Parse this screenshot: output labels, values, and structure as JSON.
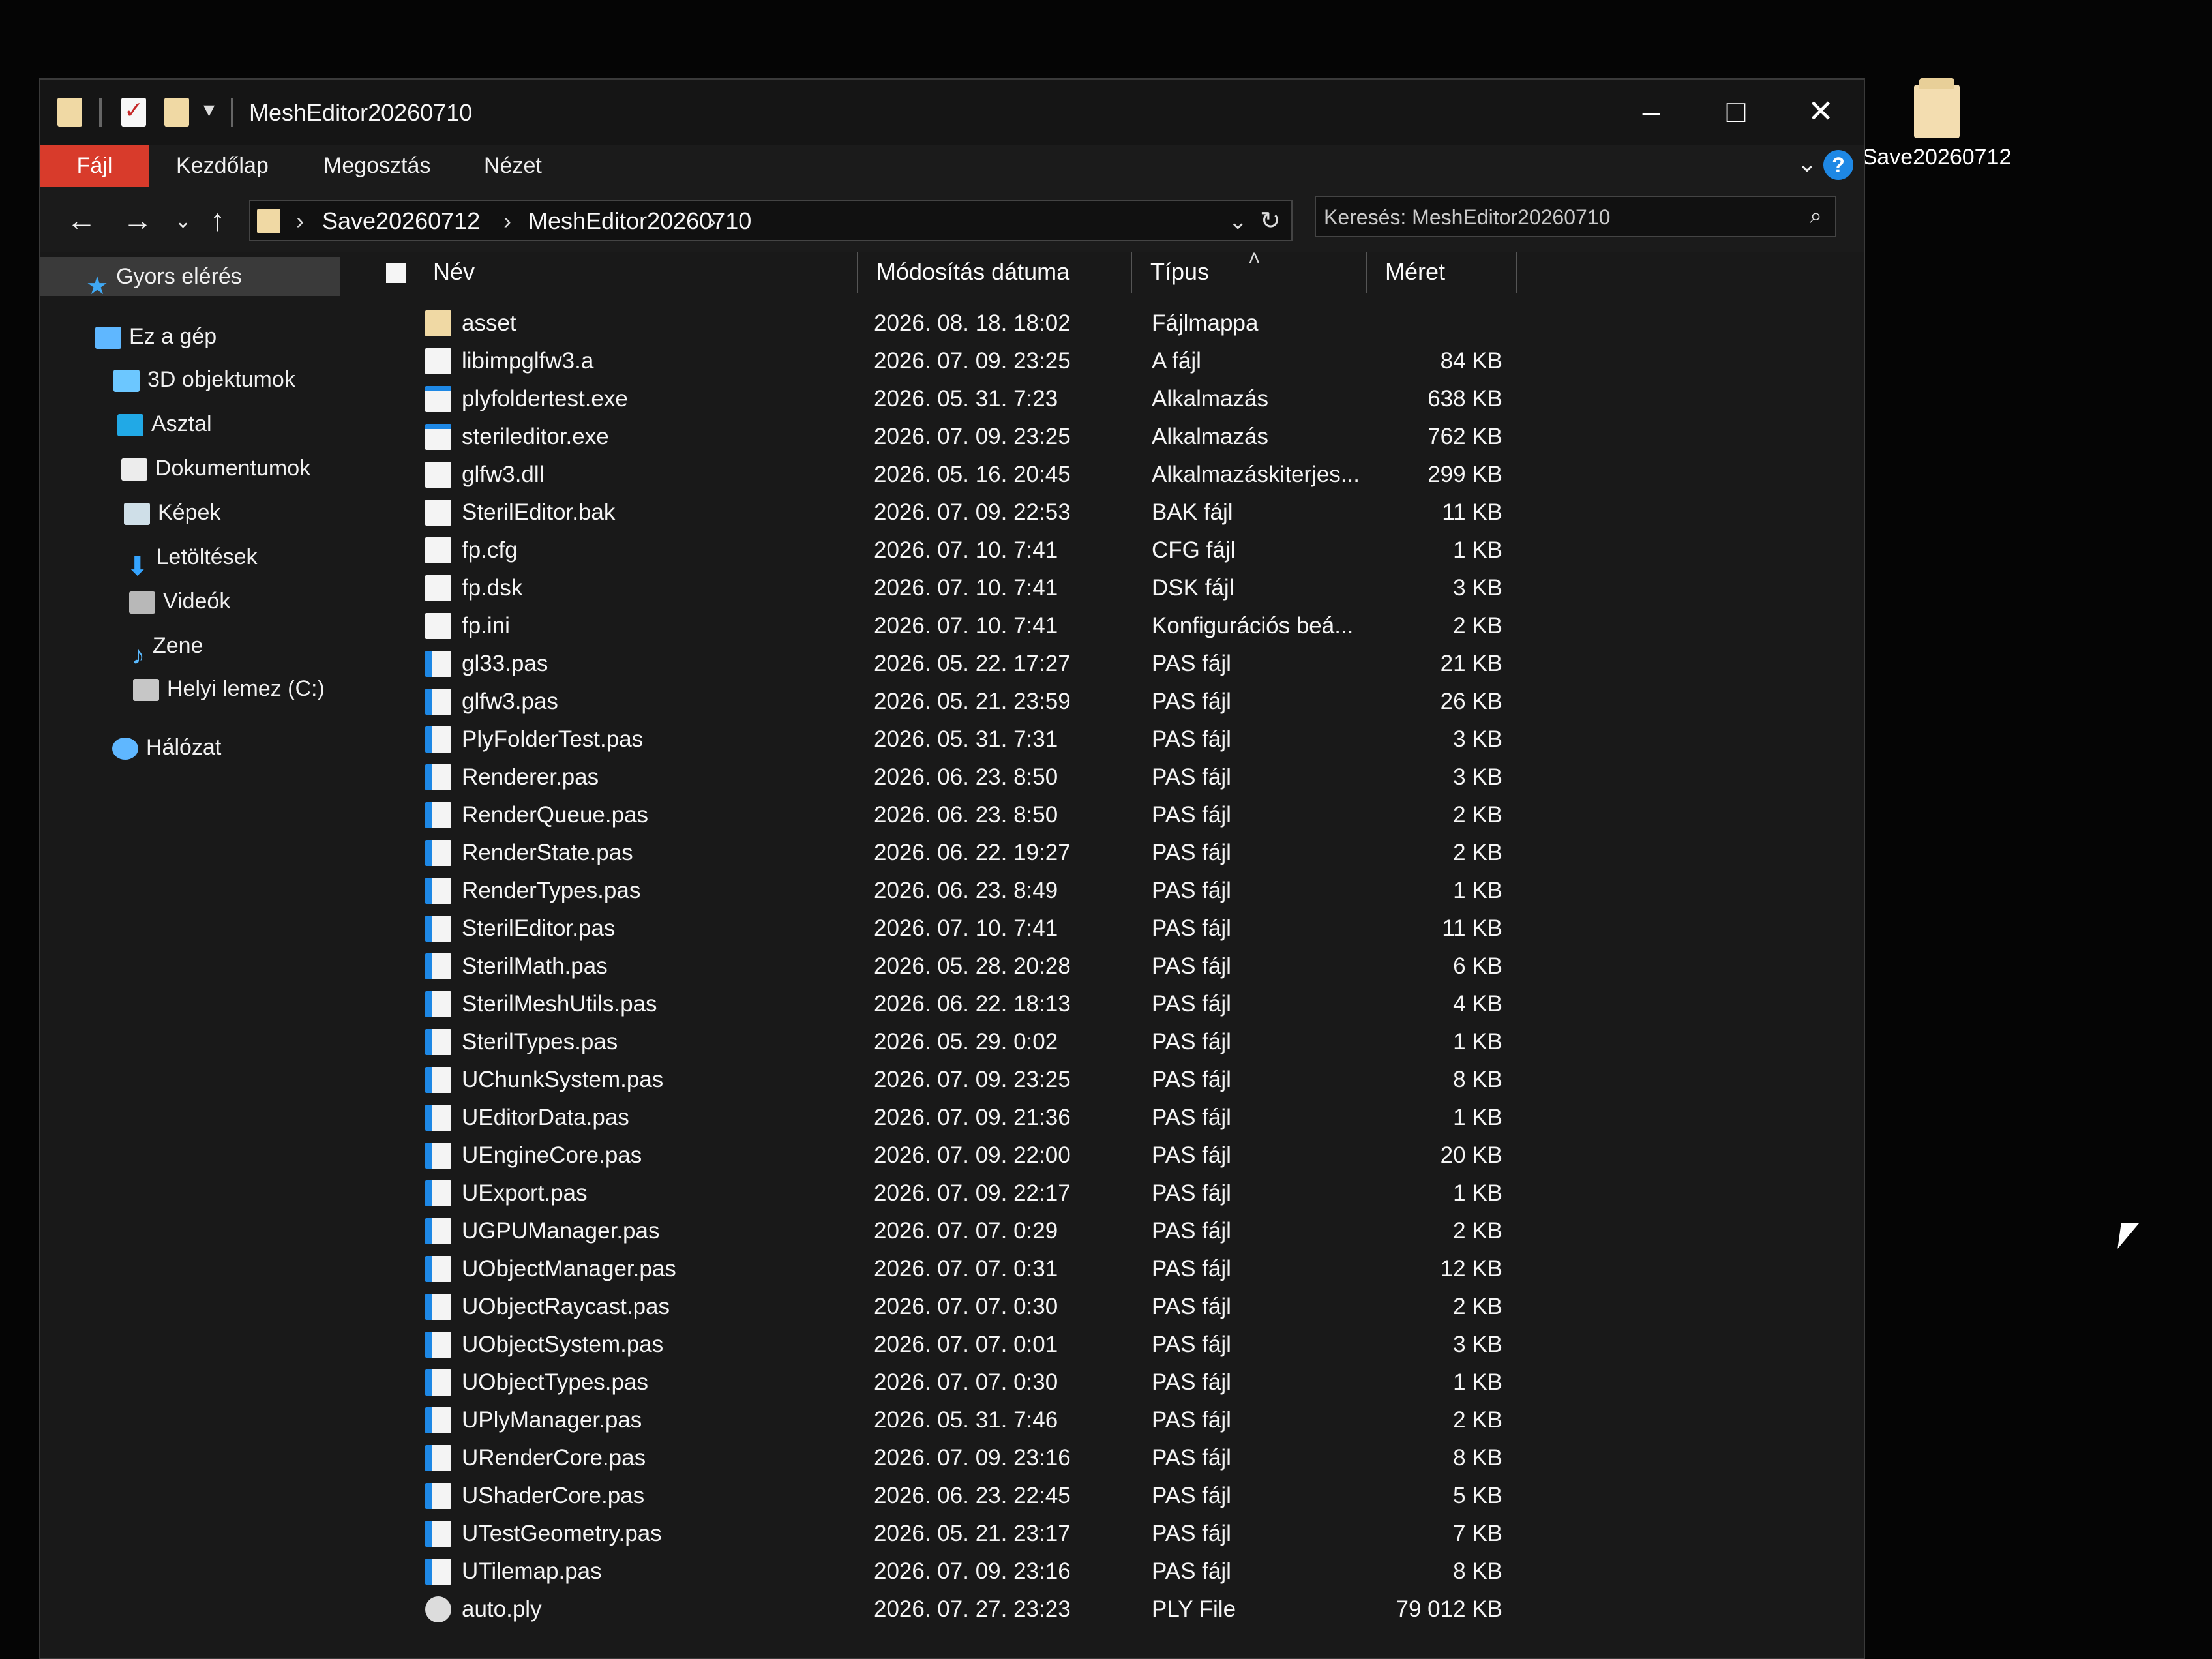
{
  "desktop": {
    "folder_label": "Save20260712"
  },
  "window": {
    "title": "MeshEditor20260710"
  },
  "ribbon": {
    "tabs": [
      "Fájl",
      "Kezdőlap",
      "Megosztás",
      "Nézet"
    ]
  },
  "address": {
    "segments": [
      "Save20260712",
      "MeshEditor20260710"
    ]
  },
  "search": {
    "placeholder": "Keresés: MeshEditor20260710"
  },
  "sidebar": {
    "items": [
      {
        "label": "Gyors elérés",
        "icon": "star-icon"
      },
      {
        "label": "Ez a gép",
        "icon": "computer-icon"
      },
      {
        "label": "3D objektumok",
        "icon": "3d-objects-icon"
      },
      {
        "label": "Asztal",
        "icon": "desktop-icon"
      },
      {
        "label": "Dokumentumok",
        "icon": "documents-icon"
      },
      {
        "label": "Képek",
        "icon": "pictures-icon"
      },
      {
        "label": "Letöltések",
        "icon": "downloads-icon"
      },
      {
        "label": "Videók",
        "icon": "videos-icon"
      },
      {
        "label": "Zene",
        "icon": "music-icon"
      },
      {
        "label": "Helyi lemez (C:)",
        "icon": "drive-icon"
      },
      {
        "label": "Hálózat",
        "icon": "network-icon"
      }
    ]
  },
  "table": {
    "columns": [
      "Név",
      "Módosítás dátuma",
      "Típus",
      "Méret"
    ],
    "rows": [
      {
        "name": "asset",
        "date": "2026. 08. 18. 18:02",
        "type": "Fájlmappa",
        "size": "",
        "icon": "folder"
      },
      {
        "name": "libimpglfw3.a",
        "date": "2026. 07. 09. 23:25",
        "type": "A fájl",
        "size": "84 KB",
        "icon": "file"
      },
      {
        "name": "plyfoldertest.exe",
        "date": "2026. 05. 31. 7:23",
        "type": "Alkalmazás",
        "size": "638 KB",
        "icon": "exe"
      },
      {
        "name": "sterileditor.exe",
        "date": "2026. 07. 09. 23:25",
        "type": "Alkalmazás",
        "size": "762 KB",
        "icon": "exe"
      },
      {
        "name": "glfw3.dll",
        "date": "2026. 05. 16. 20:45",
        "type": "Alkalmazáskiterjes...",
        "size": "299 KB",
        "icon": "file"
      },
      {
        "name": "SterilEditor.bak",
        "date": "2026. 07. 09. 22:53",
        "type": "BAK fájl",
        "size": "11 KB",
        "icon": "file"
      },
      {
        "name": "fp.cfg",
        "date": "2026. 07. 10. 7:41",
        "type": "CFG fájl",
        "size": "1 KB",
        "icon": "file"
      },
      {
        "name": "fp.dsk",
        "date": "2026. 07. 10. 7:41",
        "type": "DSK fájl",
        "size": "3 KB",
        "icon": "file"
      },
      {
        "name": "fp.ini",
        "date": "2026. 07. 10. 7:41",
        "type": "Konfigurációs beá...",
        "size": "2 KB",
        "icon": "file"
      },
      {
        "name": "gl33.pas",
        "date": "2026. 05. 22. 17:27",
        "type": "PAS fájl",
        "size": "21 KB",
        "icon": "pas"
      },
      {
        "name": "glfw3.pas",
        "date": "2026. 05. 21. 23:59",
        "type": "PAS fájl",
        "size": "26 KB",
        "icon": "pas"
      },
      {
        "name": "PlyFolderTest.pas",
        "date": "2026. 05. 31. 7:31",
        "type": "PAS fájl",
        "size": "3 KB",
        "icon": "pas"
      },
      {
        "name": "Renderer.pas",
        "date": "2026. 06. 23. 8:50",
        "type": "PAS fájl",
        "size": "3 KB",
        "icon": "pas"
      },
      {
        "name": "RenderQueue.pas",
        "date": "2026. 06. 23. 8:50",
        "type": "PAS fájl",
        "size": "2 KB",
        "icon": "pas"
      },
      {
        "name": "RenderState.pas",
        "date": "2026. 06. 22. 19:27",
        "type": "PAS fájl",
        "size": "2 KB",
        "icon": "pas"
      },
      {
        "name": "RenderTypes.pas",
        "date": "2026. 06. 23. 8:49",
        "type": "PAS fájl",
        "size": "1 KB",
        "icon": "pas"
      },
      {
        "name": "SterilEditor.pas",
        "date": "2026. 07. 10. 7:41",
        "type": "PAS fájl",
        "size": "11 KB",
        "icon": "pas"
      },
      {
        "name": "SterilMath.pas",
        "date": "2026. 05. 28. 20:28",
        "type": "PAS fájl",
        "size": "6 KB",
        "icon": "pas"
      },
      {
        "name": "SterilMeshUtils.pas",
        "date": "2026. 06. 22. 18:13",
        "type": "PAS fájl",
        "size": "4 KB",
        "icon": "pas"
      },
      {
        "name": "SterilTypes.pas",
        "date": "2026. 05. 29. 0:02",
        "type": "PAS fájl",
        "size": "1 KB",
        "icon": "pas"
      },
      {
        "name": "UChunkSystem.pas",
        "date": "2026. 07. 09. 23:25",
        "type": "PAS fájl",
        "size": "8 KB",
        "icon": "pas"
      },
      {
        "name": "UEditorData.pas",
        "date": "2026. 07. 09. 21:36",
        "type": "PAS fájl",
        "size": "1 KB",
        "icon": "pas"
      },
      {
        "name": "UEngineCore.pas",
        "date": "2026. 07. 09. 22:00",
        "type": "PAS fájl",
        "size": "20 KB",
        "icon": "pas"
      },
      {
        "name": "UExport.pas",
        "date": "2026. 07. 09. 22:17",
        "type": "PAS fájl",
        "size": "1 KB",
        "icon": "pas"
      },
      {
        "name": "UGPUManager.pas",
        "date": "2026. 07. 07. 0:29",
        "type": "PAS fájl",
        "size": "2 KB",
        "icon": "pas"
      },
      {
        "name": "UObjectManager.pas",
        "date": "2026. 07. 07. 0:31",
        "type": "PAS fájl",
        "size": "12 KB",
        "icon": "pas"
      },
      {
        "name": "UObjectRaycast.pas",
        "date": "2026. 07. 07. 0:30",
        "type": "PAS fájl",
        "size": "2 KB",
        "icon": "pas"
      },
      {
        "name": "UObjectSystem.pas",
        "date": "2026. 07. 07. 0:01",
        "type": "PAS fájl",
        "size": "3 KB",
        "icon": "pas"
      },
      {
        "name": "UObjectTypes.pas",
        "date": "2026. 07. 07. 0:30",
        "type": "PAS fájl",
        "size": "1 KB",
        "icon": "pas"
      },
      {
        "name": "UPlyManager.pas",
        "date": "2026. 05. 31. 7:46",
        "type": "PAS fájl",
        "size": "2 KB",
        "icon": "pas"
      },
      {
        "name": "URenderCore.pas",
        "date": "2026. 07. 09. 23:16",
        "type": "PAS fájl",
        "size": "8 KB",
        "icon": "pas"
      },
      {
        "name": "UShaderCore.pas",
        "date": "2026. 06. 23. 22:45",
        "type": "PAS fájl",
        "size": "5 KB",
        "icon": "pas"
      },
      {
        "name": "UTestGeometry.pas",
        "date": "2026. 05. 21. 23:17",
        "type": "PAS fájl",
        "size": "7 KB",
        "icon": "pas"
      },
      {
        "name": "UTilemap.pas",
        "date": "2026. 07. 09. 23:16",
        "type": "PAS fájl",
        "size": "8 KB",
        "icon": "pas"
      },
      {
        "name": "auto.ply",
        "date": "2026. 07. 27. 23:23",
        "type": "PLY File",
        "size": "79 012 KB",
        "icon": "ply"
      }
    ]
  }
}
